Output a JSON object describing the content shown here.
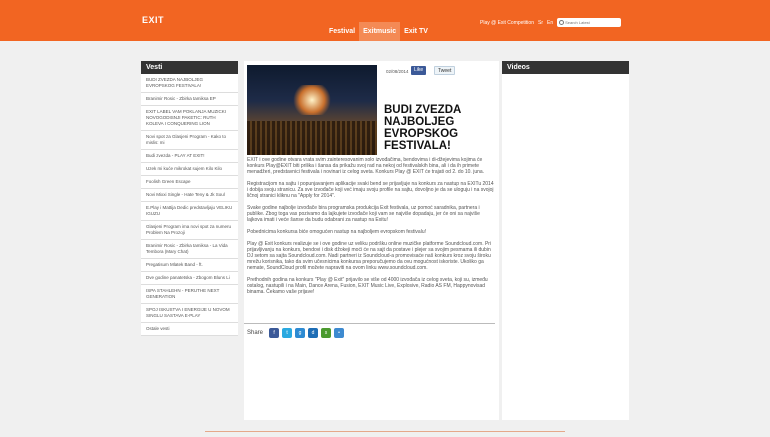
{
  "brand": {
    "logo": "EXIT",
    "accent": "#f26522"
  },
  "nav": {
    "items": [
      {
        "label": "Festival",
        "active": false
      },
      {
        "label": "Exitmusic",
        "active": true
      },
      {
        "label": "Exit TV",
        "active": false
      }
    ]
  },
  "top_right": {
    "promo": "Play @ Exit Competition",
    "lang_sr": "Sr",
    "lang_en": "En",
    "search_placeholder": "Search Latest"
  },
  "sidebar": {
    "title": "Vesti",
    "items": [
      "BUDI ZVEZDA NAJBOLJEG EVROPSKOG FESTIVALA!",
      "Branimir Rosic - Zbirka tamiksa EP",
      "EXIT LABEL VAM POKLANJA MUZICKI NOVOGODISNJI PAKETIC: RUTH KOLEVA I CONQUERING LION",
      "Novi spot za Glasjeni Program - Kako to mislis: mi",
      "Budi zvezda - PLAY AT EXIT!",
      "Uzek mi kuće mikrokat sujem Kilo Kilo",
      "Foolish Green Escape",
      "Novi Mixxi Single - Hate Teny & Jk Soul",
      "E.Play i Mattija Dedic predstavljaju VELIKU IGUZU",
      "Glasjeni Program ima novi spot za numeru Problem Na Prozoji",
      "Branimir Rosic - Zbirka tamiksa - La Vida Tembora (Mary Chat)",
      "Pregatisum Mlatek Band - ft.",
      "Dve godine panatetska - Zbogom Bluns Li",
      "ISPA STAHLEHN - PERUTHE NEXT GENERATION",
      "SPOJ ISKUSTVA I ENERGIJE U NOVOM SINGLU SASTAVA E-PLAY",
      "Ostale vesti"
    ]
  },
  "article": {
    "date": "02/08/2014",
    "like_label": "Like",
    "tweet_label": "Tweet",
    "headline": "BUDI ZVEZDA NAJBOLJEG EVROPSKOG FESTIVALA!",
    "paragraphs": [
      "EXIT i ove godine otvara vrata svim zainteresovanim solo izvođačima, bendovima i di-džejevima kojima će konkurs Play@EXIT biti prilika i šansa da prikažu svoj rad na nekoj od festivalskih bina, ali i da ih primete menadžeri, predstavnici festivala i novinari iz celog sveta. Konkurs Play @ EXIT će trajati od 2. do 10. juna.",
      "Registracijom na sajtu i popunjavanjem aplikacije svaki bend se prijavljuje na konkurs za nastup na EXITu 2014 i dobija svoju stranicu. Za sve izvođače koji već imaju svoju profile na sajtu, dovoljno je da se uloguju i na svojoj ličnoj stranici kliknu na \"Apply for 2014\".",
      "Svake godine najbolje izvođače bira programska produkcija Exit festivala, uz pomoć saradnika, partnera i publike. Zbog toga vas pozivamo da lajkujete izvođače koji vam se najviše dopadaju, jer će oni sa najviše lajkova imati i veće šanse da budu odabrani za nastup na Exitu!",
      "Pobednicima konkursa biće omogućen nastup na najboljem evropskom festivalu!",
      "Play @ Exit konkurs realizuje se i ove godine uz veliku podršku online muzičke platforme Soundcloud.com. Pri prijavljivanju na konkurs, bendovi i disk džokeji moći će na sajt da postave i plejer sa svojim pesmama ili dubin DJ setom sa sajta Soundcloud.com. Nadi partneri iz Soundcloud-a promovisaće naš konkurs kroz svoju široku mrežu korisnika, tako da svim učesnicima konkursa preporučujemo da ovu mogućnost iskoriste. Ukoliko ga nemate, SoundCloud profil možete napraviti na ovom linku www.soundcloud.com.",
      "Prethodnih godina na konkurs \"Play @ Exit\" prijavilo se više od 4000 izvođača iz celog sveta, koji su, između ostalog, nastupili i na Main, Dance Arena, Fusion, EXIT Music Live, Explosive, Radio AS FM, Happynovisad binama. Čekamo vaše prijave!"
    ]
  },
  "share": {
    "label": "Share",
    "icons": [
      {
        "name": "facebook-share-icon",
        "glyph": "f",
        "color": "#3b5998"
      },
      {
        "name": "twitter-share-icon",
        "glyph": "t",
        "color": "#2aa9e0"
      },
      {
        "name": "google-plus-share-icon",
        "glyph": "g",
        "color": "#2d8bd3"
      },
      {
        "name": "digg-share-icon",
        "glyph": "d",
        "color": "#1d6db5"
      },
      {
        "name": "stumble-share-icon",
        "glyph": "s",
        "color": "#4b9a2f"
      },
      {
        "name": "delicious-share-icon",
        "glyph": "•",
        "color": "#3d8ad0"
      }
    ]
  },
  "videos": {
    "title": "Videos"
  }
}
